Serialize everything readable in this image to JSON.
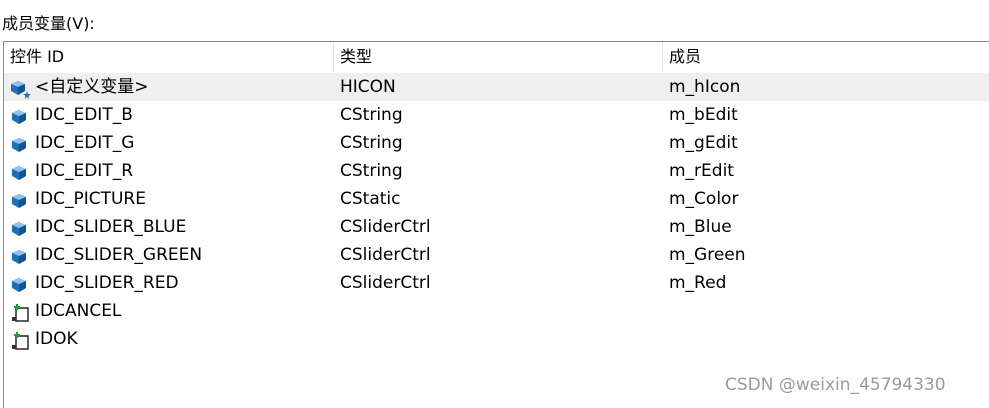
{
  "title": "成员变量(V):",
  "columns": [
    "控件 ID",
    "类型",
    "成员"
  ],
  "rows": [
    {
      "id": "<自定义变量>",
      "type": "HICON",
      "member": "m_hIcon",
      "icon": "custom-variable-icon",
      "selected": true
    },
    {
      "id": "IDC_EDIT_B",
      "type": "CString",
      "member": "m_bEdit",
      "icon": "control-variable-icon"
    },
    {
      "id": "IDC_EDIT_G",
      "type": "CString",
      "member": "m_gEdit",
      "icon": "control-variable-icon"
    },
    {
      "id": "IDC_EDIT_R",
      "type": "CString",
      "member": "m_rEdit",
      "icon": "control-variable-icon"
    },
    {
      "id": "IDC_PICTURE",
      "type": "CStatic",
      "member": "m_Color",
      "icon": "control-variable-icon"
    },
    {
      "id": "IDC_SLIDER_BLUE",
      "type": "CSliderCtrl",
      "member": "m_Blue",
      "icon": "control-variable-icon"
    },
    {
      "id": "IDC_SLIDER_GREEN",
      "type": "CSliderCtrl",
      "member": "m_Green",
      "icon": "control-variable-icon"
    },
    {
      "id": "IDC_SLIDER_RED",
      "type": "CSliderCtrl",
      "member": "m_Red",
      "icon": "control-variable-icon"
    },
    {
      "id": "IDCANCEL",
      "type": "",
      "member": "",
      "icon": "add-control-icon"
    },
    {
      "id": "IDOK",
      "type": "",
      "member": "",
      "icon": "add-control-icon"
    }
  ],
  "watermark": "CSDN @weixin_45794330"
}
